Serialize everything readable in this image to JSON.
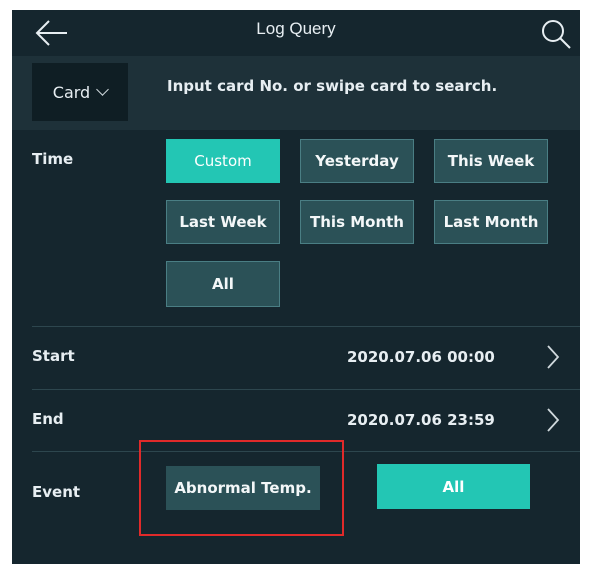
{
  "header": {
    "title": "Log Query",
    "back_icon": "back-arrow-icon",
    "search_icon": "search-icon"
  },
  "search": {
    "type_label": "Card",
    "hint": "Input card No. or swipe card to search."
  },
  "time": {
    "label": "Time",
    "options": [
      "Custom",
      "Yesterday",
      "This Week",
      "Last Week",
      "This Month",
      "Last Month",
      "All"
    ],
    "selected": "Custom"
  },
  "start": {
    "label": "Start",
    "value": "2020.07.06  00:00"
  },
  "end": {
    "label": "End",
    "value": "2020.07.06  23:59"
  },
  "event": {
    "label": "Event",
    "options": [
      "Abnormal Temp.",
      "All"
    ],
    "selected": "All"
  },
  "colors": {
    "background": "#15262e",
    "accent": "#23c6b4",
    "button": "#2b5157",
    "highlight": "#e02a2a"
  }
}
